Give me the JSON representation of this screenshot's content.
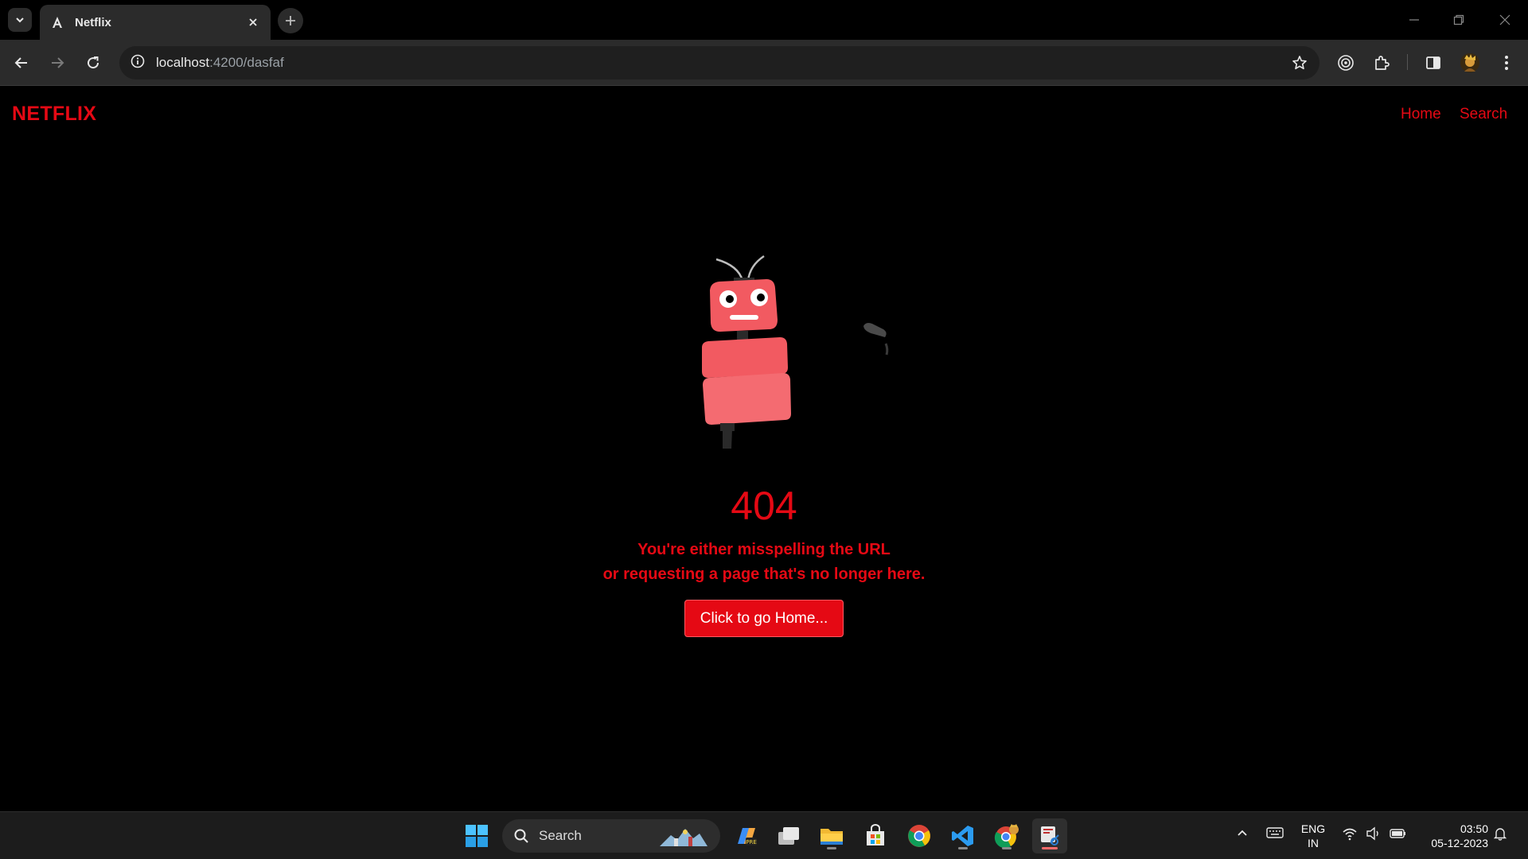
{
  "browser": {
    "tab_title": "Netflix",
    "url_host": "localhost",
    "url_rest": ":4200/dasfaf"
  },
  "navbar": {
    "brand": "NETFLIX",
    "links": [
      "Home",
      "Search"
    ]
  },
  "error": {
    "code": "404",
    "line1": "You're either misspelling the URL",
    "line2": "or requesting a page that's no longer here.",
    "button_label": "Click to go Home..."
  },
  "taskbar": {
    "search_label": "Search",
    "lang_line1": "ENG",
    "lang_line2": "IN",
    "time": "03:50",
    "date": "05-12-2023"
  },
  "colors": {
    "brand_red": "#e50914",
    "robot_pink": "#f25a61",
    "page_bg": "#000000"
  }
}
